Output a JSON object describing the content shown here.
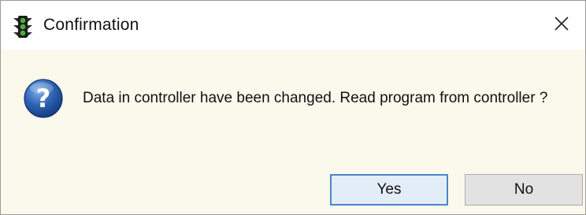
{
  "window": {
    "title": "Confirmation",
    "app_icon": "traffic-light-icon",
    "close_icon": "close-icon"
  },
  "message": {
    "icon": "question-icon",
    "text": "Data in controller have been changed. Read program from controller ?"
  },
  "buttons": {
    "yes_label": "Yes",
    "no_label": "No"
  },
  "colors": {
    "dialog_background": "#fbf8ec",
    "titlebar_background": "#ffffff",
    "default_button_border": "#4a86c8",
    "default_button_background": "#e3edf7",
    "button_background": "#e2e2e2",
    "question_icon_blue": "#2f63b3"
  }
}
